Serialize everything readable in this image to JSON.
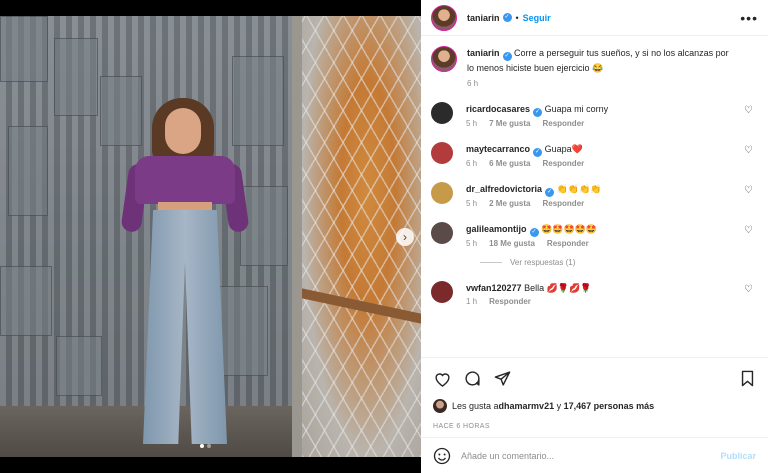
{
  "post": {
    "username": "taniarin",
    "follow_label": "Seguir",
    "more_label": "•••",
    "caption_text": "Corre a perseguir tus sueños, y si no los alcanzas por lo menos hiciste buen ejercicio 😂",
    "caption_time": "6 h",
    "image_alt": "Mujer con blusa morada y jeans de pie frente a una pared de lámina",
    "carousel_dots": 2,
    "carousel_active": 0,
    "next_icon": "chevron-right-icon"
  },
  "comments": [
    {
      "username": "ricardocasares",
      "text": "Guapa mi corny",
      "time": "5 h",
      "likes": "7 Me gusta",
      "reply": "Responder",
      "avatar_color": "#2b2b2b"
    },
    {
      "username": "maytecarranco",
      "text": "Guapa❤️",
      "time": "6 h",
      "likes": "6 Me gusta",
      "reply": "Responder",
      "avatar_color": "#b23b3b"
    },
    {
      "username": "dr_alfredovictoria",
      "text": "👏👏👏👏",
      "time": "5 h",
      "likes": "2 Me gusta",
      "reply": "Responder",
      "avatar_color": "#c79a4a"
    },
    {
      "username": "galileamontijo",
      "text": "🤩🤩🤩🤩🤩",
      "time": "5 h",
      "likes": "18 Me gusta",
      "reply": "Responder",
      "avatar_color": "#5a4a48",
      "view_replies": "Ver respuestas (1)"
    },
    {
      "username": "vwfan120277",
      "text": "Bella 💋🌹💋🌹",
      "time": "1 h",
      "likes": "",
      "reply": "Responder",
      "avatar_color": "#7a2a2a"
    }
  ],
  "actions": {
    "like_icon": "heart-icon",
    "comment_icon": "comment-icon",
    "share_icon": "send-icon",
    "save_icon": "bookmark-icon"
  },
  "likes_summary": {
    "prefix": "Les gusta a ",
    "user": "dhamarmv21",
    "middle": " y ",
    "count": "17,467 personas más"
  },
  "post_date": "HACE 6 HORAS",
  "add_comment": {
    "emoji_icon": "emoji-icon",
    "placeholder": "Añade un comentario...",
    "publish_label": "Publicar"
  },
  "colors": {
    "link_blue": "#0095f6",
    "verified_blue": "#3897f0",
    "muted_text": "#8e8e8e",
    "publish_disabled": "#b2dffc"
  }
}
